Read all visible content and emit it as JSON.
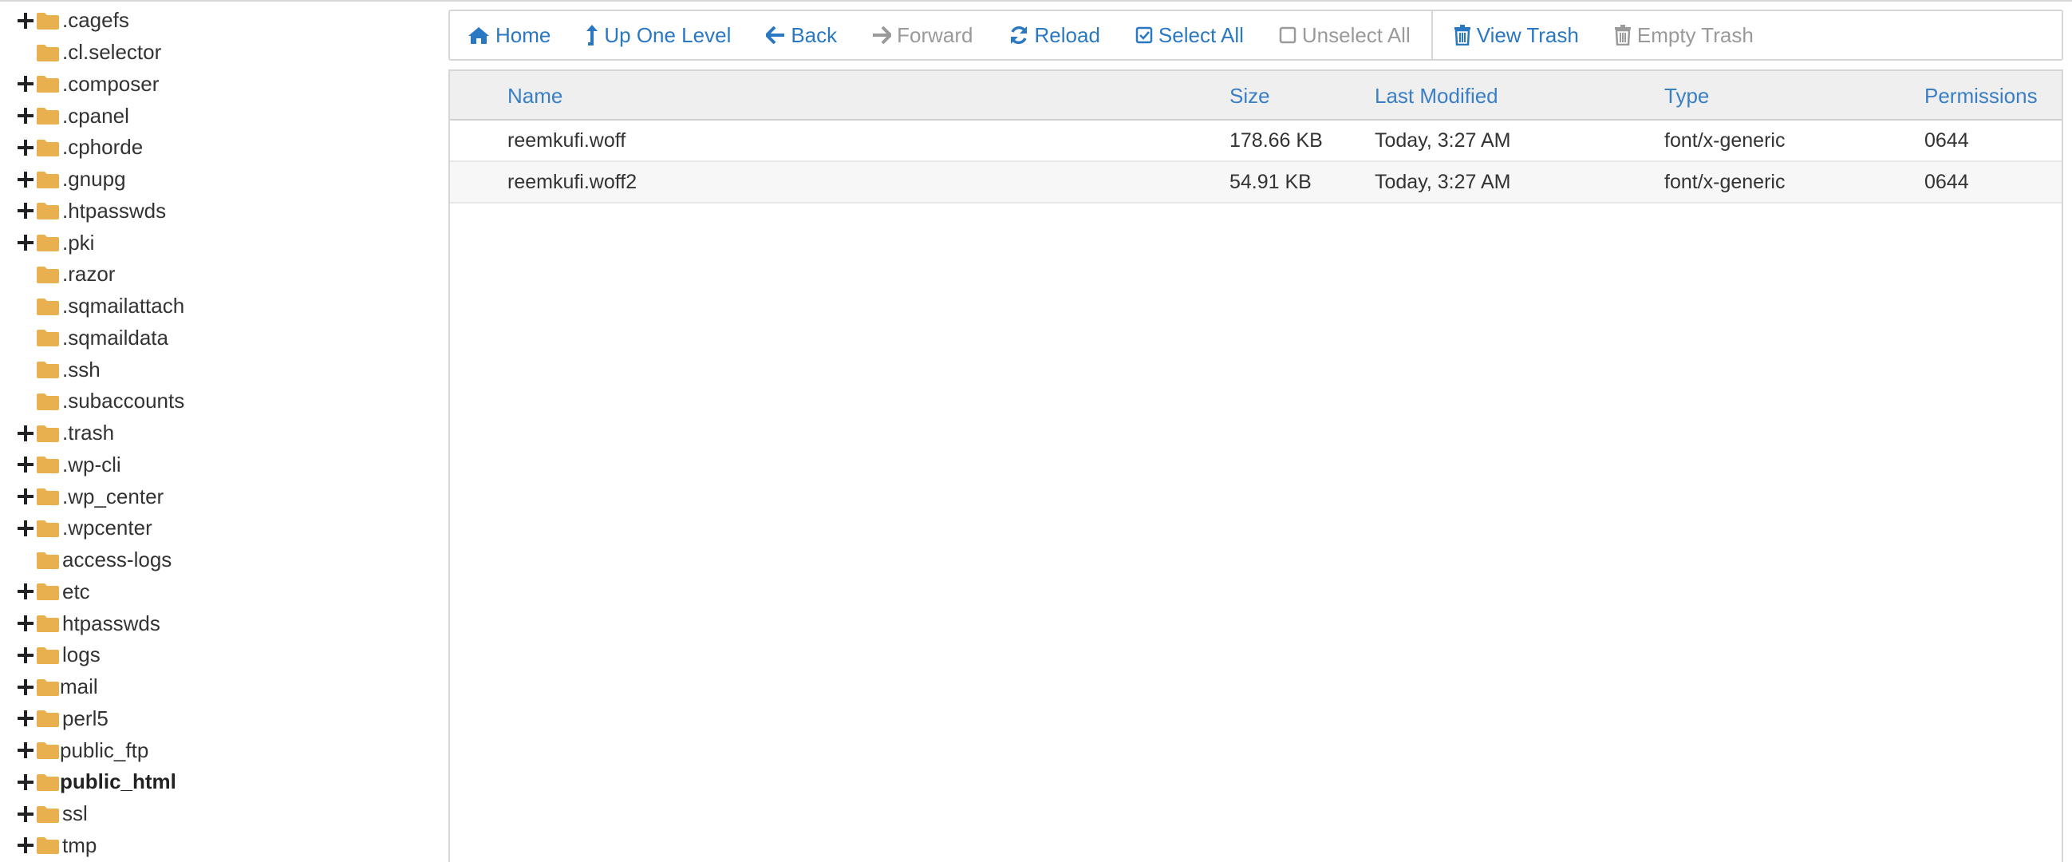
{
  "tree": {
    "items": [
      {
        "label": ".cagefs",
        "expandable": true,
        "bold": false
      },
      {
        "label": ".cl.selector",
        "expandable": false,
        "bold": false
      },
      {
        "label": ".composer",
        "expandable": true,
        "bold": false
      },
      {
        "label": ".cpanel",
        "expandable": true,
        "bold": false
      },
      {
        "label": ".cphorde",
        "expandable": true,
        "bold": false
      },
      {
        "label": ".gnupg",
        "expandable": true,
        "bold": false
      },
      {
        "label": ".htpasswds",
        "expandable": true,
        "bold": false
      },
      {
        "label": ".pki",
        "expandable": true,
        "bold": false
      },
      {
        "label": ".razor",
        "expandable": false,
        "bold": false
      },
      {
        "label": ".sqmailattach",
        "expandable": false,
        "bold": false
      },
      {
        "label": ".sqmaildata",
        "expandable": false,
        "bold": false
      },
      {
        "label": ".ssh",
        "expandable": false,
        "bold": false
      },
      {
        "label": ".subaccounts",
        "expandable": false,
        "bold": false
      },
      {
        "label": ".trash",
        "expandable": true,
        "bold": false
      },
      {
        "label": ".wp-cli",
        "expandable": true,
        "bold": false
      },
      {
        "label": ".wp_center",
        "expandable": true,
        "bold": false
      },
      {
        "label": ".wpcenter",
        "expandable": true,
        "bold": false
      },
      {
        "label": "access-logs",
        "expandable": false,
        "bold": false
      },
      {
        "label": "etc",
        "expandable": true,
        "bold": false
      },
      {
        "label": "htpasswds",
        "expandable": true,
        "bold": false
      },
      {
        "label": "logs",
        "expandable": true,
        "bold": false
      },
      {
        "label": "mail",
        "expandable": true,
        "bold": false
      },
      {
        "label": "perl5",
        "expandable": true,
        "bold": false
      },
      {
        "label": "public_ftp",
        "expandable": true,
        "bold": false
      },
      {
        "label": "public_html",
        "expandable": true,
        "bold": true
      },
      {
        "label": "ssl",
        "expandable": true,
        "bold": false
      },
      {
        "label": "tmp",
        "expandable": true,
        "bold": false
      }
    ],
    "folder_icon": "folder-icon",
    "expander_icon": "plus-icon"
  },
  "toolbar": {
    "home": "Home",
    "up_one_level": "Up One Level",
    "back": "Back",
    "forward": "Forward",
    "reload": "Reload",
    "select_all": "Select All",
    "unselect_all": "Unselect All",
    "view_trash": "View Trash",
    "empty_trash": "Empty Trash"
  },
  "table": {
    "columns": {
      "name": "Name",
      "size": "Size",
      "last_modified": "Last Modified",
      "type": "Type",
      "permissions": "Permissions"
    },
    "rows": [
      {
        "name": "reemkufi.woff",
        "size": "178.66 KB",
        "last_modified": "Today, 3:27 AM",
        "type": "font/x-generic",
        "permissions": "0644"
      },
      {
        "name": "reemkufi.woff2",
        "size": "54.91 KB",
        "last_modified": "Today, 3:27 AM",
        "type": "font/x-generic",
        "permissions": "0644"
      }
    ]
  },
  "colors": {
    "link": "#2b78c2",
    "disabled": "#9a9a9a",
    "folder": "#e8b04f",
    "header_bg": "#efefef"
  }
}
